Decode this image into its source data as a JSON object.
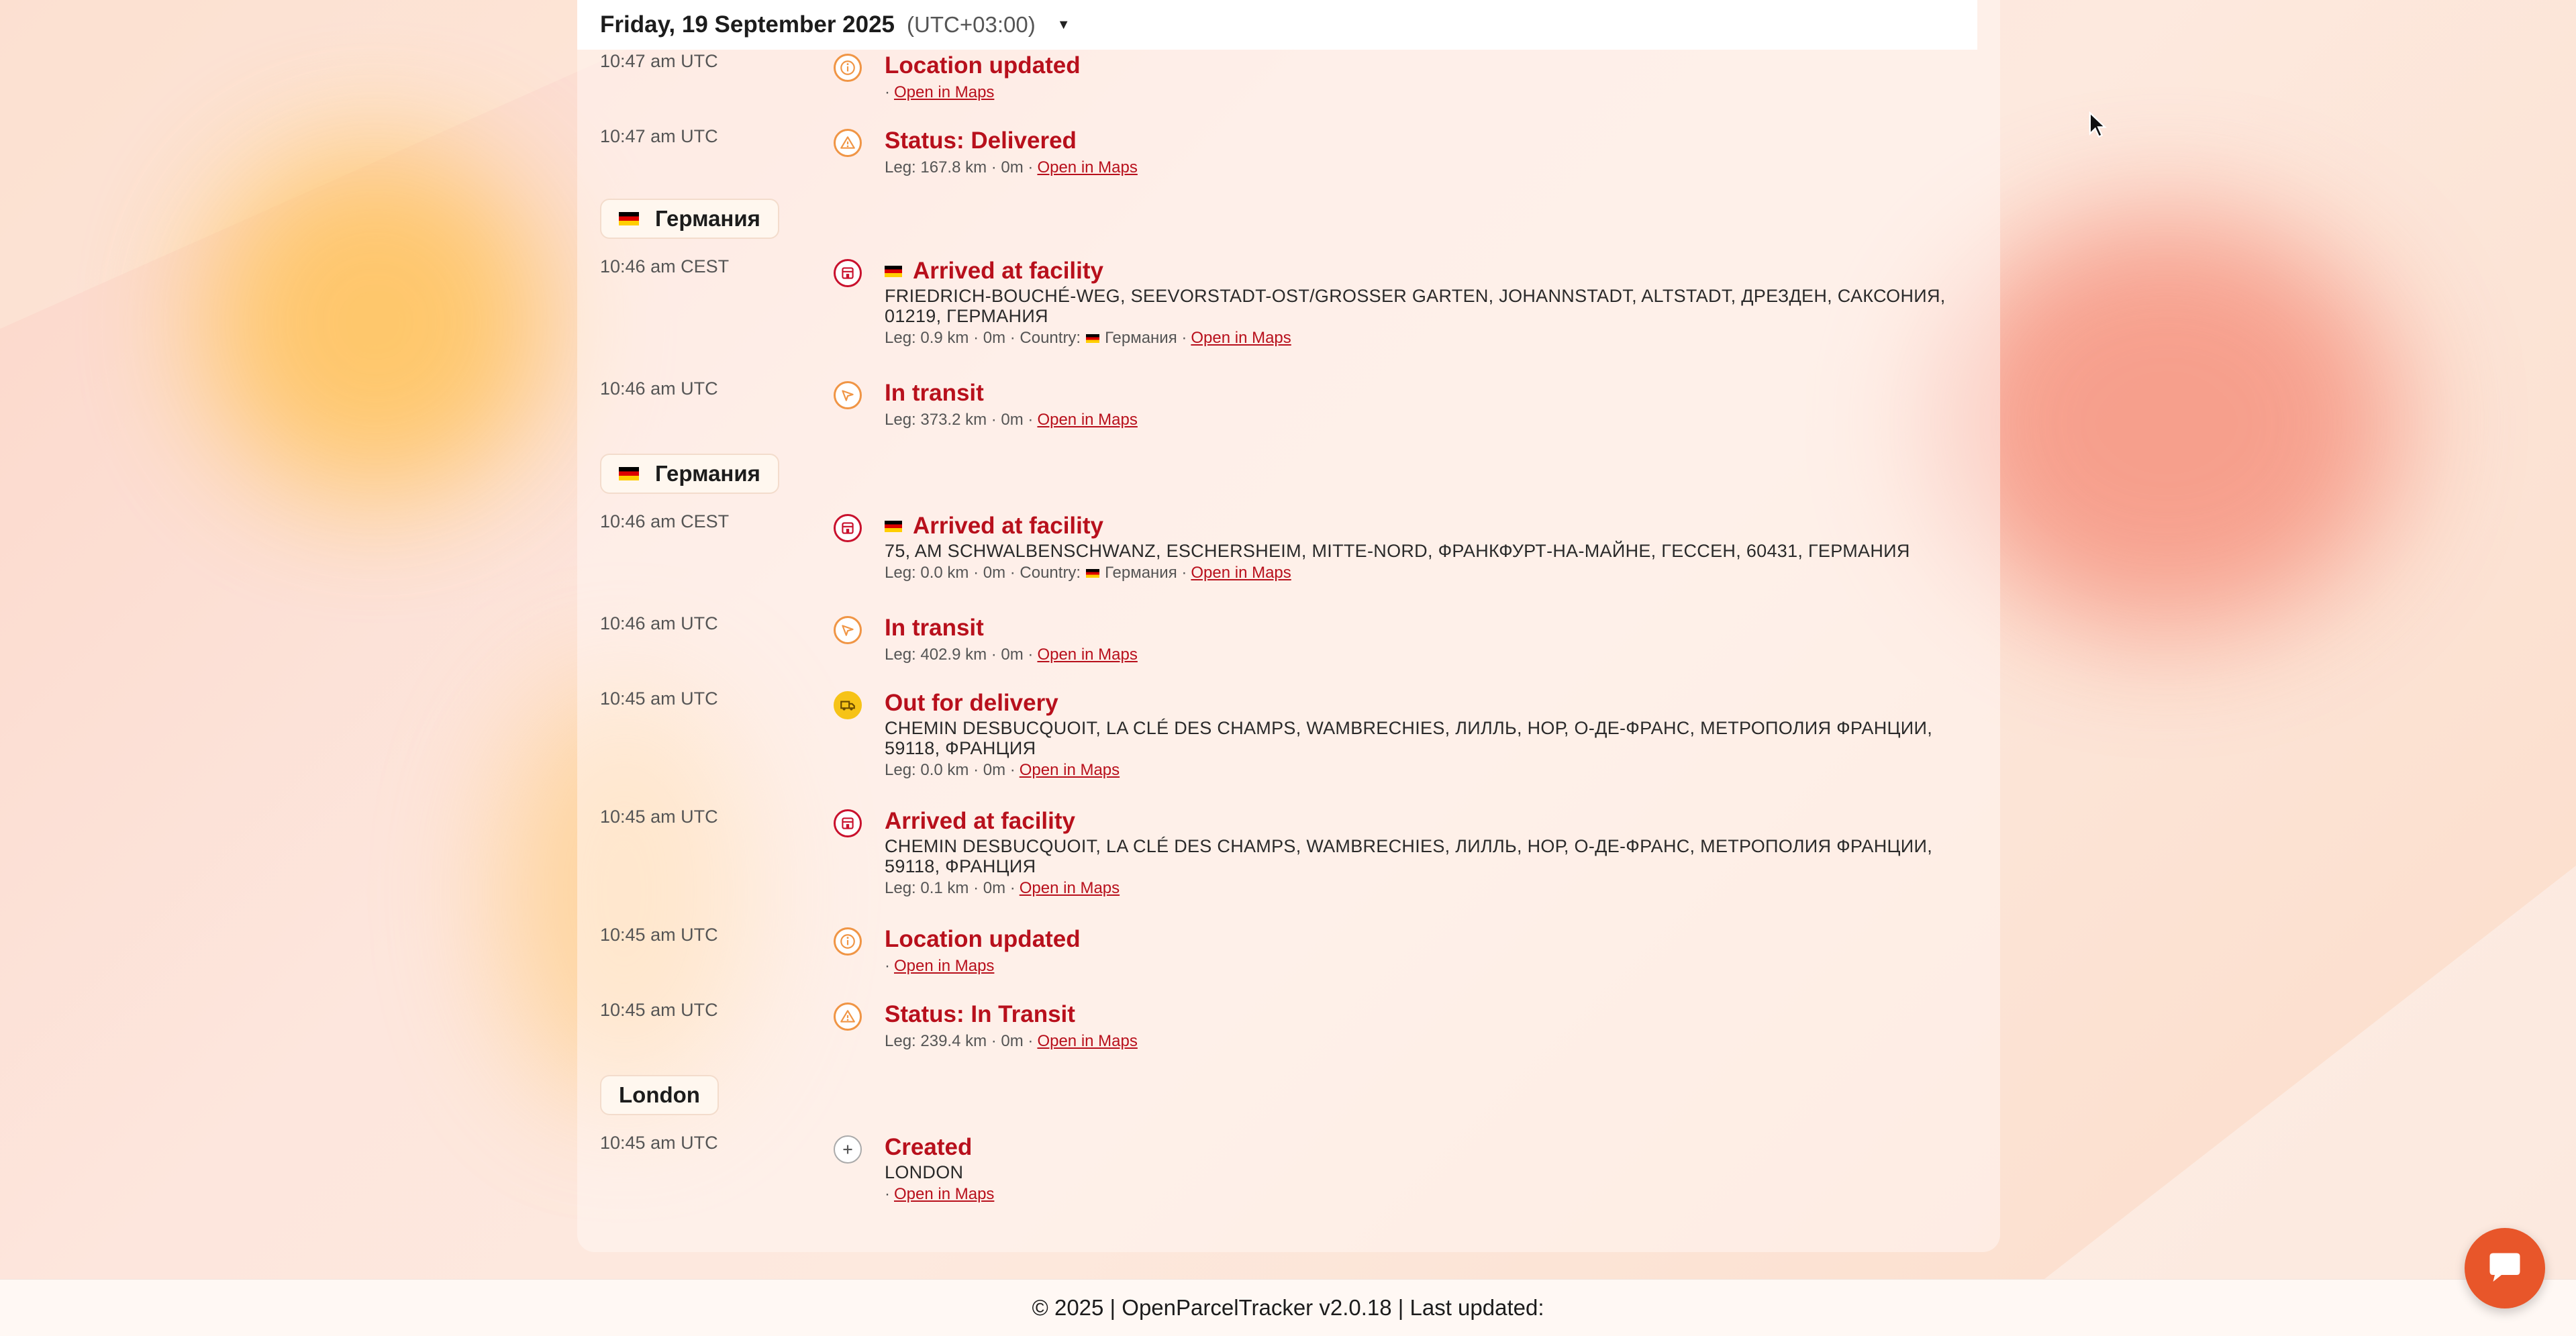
{
  "header": {
    "date": "Friday, 19 September 2025",
    "timezone": "(UTC+03:00)",
    "caret": "▼"
  },
  "groups": [
    {
      "label": "Германия"
    },
    {
      "label": "Германия"
    },
    {
      "label": "London"
    }
  ],
  "events": [
    {
      "time": "10:47 am UTC",
      "title": "Location updated",
      "icon": "info-icon",
      "meta": "·",
      "link": "Open in Maps"
    },
    {
      "time": "10:47 am UTC",
      "title": "Status: Delivered",
      "icon": "warning-icon",
      "meta": "Leg: 167.8 km · 0m ·",
      "link": "Open in Maps"
    },
    {
      "time": "10:46 am CEST",
      "title": "Arrived at facility",
      "icon": "facility-icon",
      "address": "FRIEDRICH-BOUCHÉ-WEG, SEEVORSTADT-OST/GROSSER GARTEN, JOHANNSTADT, ALTSTADT, ДРЕЗДЕН, САКСОНИЯ, 01219, ГЕРМАНИЯ",
      "meta": "Leg: 0.9 km · 0m · Country:",
      "country": "Германия ·",
      "link": "Open in Maps"
    },
    {
      "time": "10:46 am UTC",
      "title": "In transit",
      "icon": "transit-icon",
      "meta": "Leg: 373.2 km · 0m ·",
      "link": "Open in Maps"
    },
    {
      "time": "10:46 am CEST",
      "title": "Arrived at facility",
      "icon": "facility-icon",
      "address": "75, AM SCHWALBENSCHWANZ, ESCHERSHEIM, MITTE-NORD, ФРАНКФУРТ-НА-МАЙНЕ, ГЕССЕН, 60431, ГЕРМАНИЯ",
      "meta": "Leg: 0.0 km · 0m · Country:",
      "country": "Германия ·",
      "link": "Open in Maps"
    },
    {
      "time": "10:46 am UTC",
      "title": "In transit",
      "icon": "transit-icon",
      "meta": "Leg: 402.9 km · 0m ·",
      "link": "Open in Maps"
    },
    {
      "time": "10:45 am UTC",
      "title": "Out for delivery",
      "icon": "truck-icon",
      "address": "CHEMIN DESBUCQUOIT, LA CLÉ DES CHAMPS, WAMBRECHIES, ЛИЛЛЬ, НОР, О-ДЕ-ФРАНС, МЕТРОПОЛИЯ ФРАНЦИИ, 59118, ФРАНЦИЯ",
      "meta": "Leg: 0.0 km · 0m ·",
      "link": "Open in Maps"
    },
    {
      "time": "10:45 am UTC",
      "title": "Arrived at facility",
      "icon": "facility-icon",
      "address": "CHEMIN DESBUCQUOIT, LA CLÉ DES CHAMPS, WAMBRECHIES, ЛИЛЛЬ, НОР, О-ДЕ-ФРАНС, МЕТРОПОЛИЯ ФРАНЦИИ, 59118, ФРАНЦИЯ",
      "meta": "Leg: 0.1 km · 0m ·",
      "link": "Open in Maps"
    },
    {
      "time": "10:45 am UTC",
      "title": "Location updated",
      "icon": "info-icon",
      "meta": "·",
      "link": "Open in Maps"
    },
    {
      "time": "10:45 am UTC",
      "title": "Status: In Transit",
      "icon": "warning-icon",
      "meta": "Leg: 239.4 km · 0m ·",
      "link": "Open in Maps"
    },
    {
      "time": "10:45 am UTC",
      "title": "Created",
      "icon": "plus-icon",
      "address": "LONDON",
      "meta": "·",
      "link": "Open in Maps"
    }
  ],
  "footer": {
    "text": "© 2025 | OpenParcelTracker v2.0.18 | Last updated:"
  },
  "colors": {
    "accent": "#b8101c",
    "orange": "#f09545",
    "yellow": "#f6c317",
    "chat": "#e8562a"
  }
}
